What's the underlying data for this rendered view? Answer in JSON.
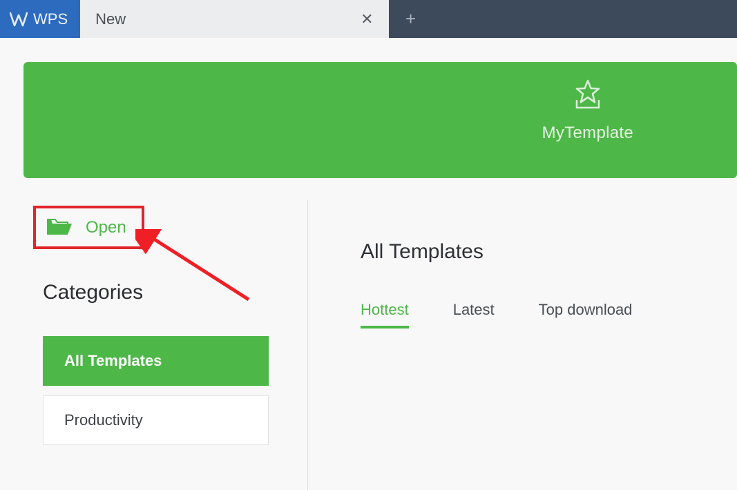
{
  "titlebar": {
    "app_name": "WPS",
    "tab_label": "New"
  },
  "banner": {
    "my_template": "MyTemplate"
  },
  "sidebar": {
    "open_label": "Open",
    "categories_heading": "Categories",
    "categories": [
      {
        "label": "All Templates"
      },
      {
        "label": "Productivity"
      }
    ]
  },
  "main": {
    "title": "All Templates",
    "filters": [
      {
        "label": "Hottest"
      },
      {
        "label": "Latest"
      },
      {
        "label": "Top download"
      }
    ]
  }
}
